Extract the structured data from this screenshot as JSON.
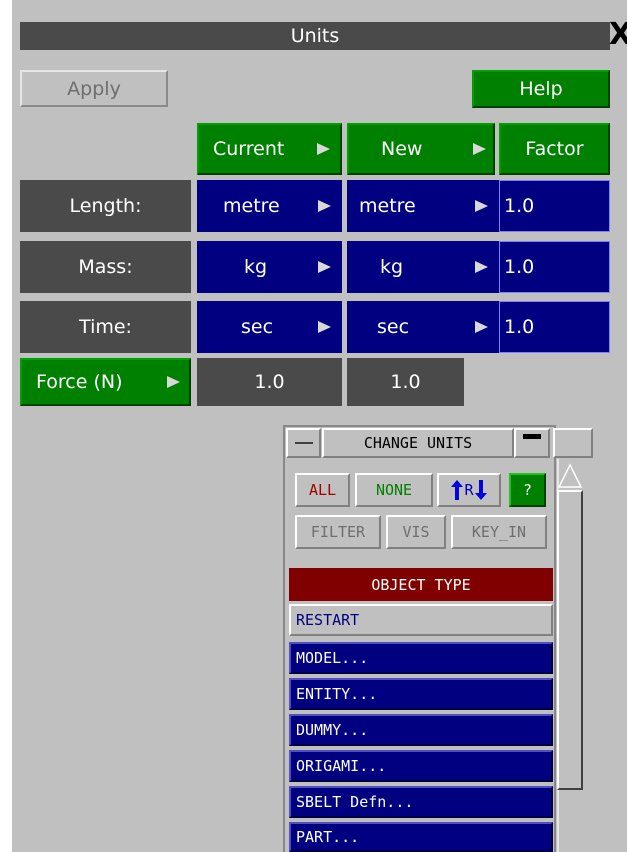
{
  "window": {
    "title": "Units",
    "close_glyph": "X"
  },
  "toolbar": {
    "apply_label": "Apply",
    "help_label": "Help"
  },
  "headers": {
    "current": "Current",
    "new": "New",
    "factor": "Factor"
  },
  "rows": [
    {
      "label": "Length:",
      "current": "metre",
      "new": "metre",
      "factor": "1.0"
    },
    {
      "label": "Mass:",
      "current": "kg",
      "new": "kg",
      "factor": "1.0"
    },
    {
      "label": "Time:",
      "current": "sec",
      "new": "sec",
      "factor": "1.0"
    }
  ],
  "force": {
    "label": "Force (N)",
    "current": "1.0",
    "new": "1.0"
  },
  "change_units": {
    "title": "CHANGE UNITS",
    "buttons": {
      "all": "ALL",
      "none": "NONE",
      "reverse": "R",
      "help": "?",
      "filter": "FILTER",
      "vis": "VIS",
      "key_in": "KEY_IN"
    },
    "object_type_header": "OBJECT TYPE",
    "items": [
      "RESTART",
      "MODEL...",
      "ENTITY...",
      "DUMMY...",
      "ORIGAMI...",
      "SBELT Defn...",
      "PART..."
    ]
  },
  "colors": {
    "panel": "#c0c0c0",
    "dark": "#4a4a4a",
    "green": "#008000",
    "blue": "#000080",
    "header_red": "#800000"
  }
}
